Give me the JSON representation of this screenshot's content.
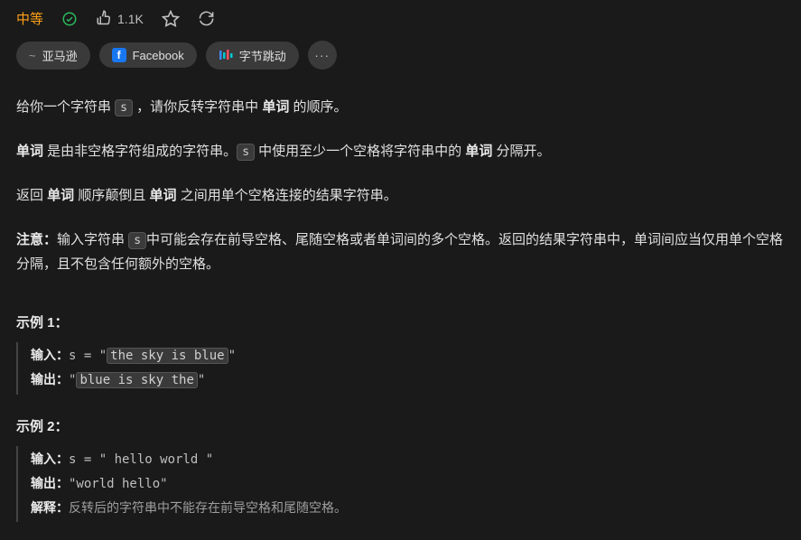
{
  "header": {
    "difficulty": "中等",
    "likes": "1.1K"
  },
  "tags": {
    "prefix": "~",
    "amazon": "亚马逊",
    "facebook": "Facebook",
    "bytedance": "字节跳动",
    "more": "···"
  },
  "problem": {
    "p1_a": "给你一个字符串 ",
    "p1_code": "s",
    "p1_b": " ，请你反转字符串中 ",
    "p1_bold": "单词",
    "p1_c": " 的顺序。",
    "p2_bold1": "单词",
    "p2_a": " 是由非空格字符组成的字符串。",
    "p2_code": "s",
    "p2_b": " 中使用至少一个空格将字符串中的 ",
    "p2_bold2": "单词",
    "p2_c": " 分隔开。",
    "p3_a": "返回 ",
    "p3_bold1": "单词",
    "p3_b": " 顺序颠倒且 ",
    "p3_bold2": "单词",
    "p3_c": " 之间用单个空格连接的结果字符串。",
    "p4_bold": "注意：",
    "p4_a": "输入字符串 ",
    "p4_code": "s",
    "p4_b": "中可能会存在前导空格、尾随空格或者单词间的多个空格。返回的结果字符串中，单词间应当仅用单个空格分隔，且不包含任何额外的空格。"
  },
  "examples": [
    {
      "title": "示例 1：",
      "input_label": "输入：",
      "input_value_a": "s = \"",
      "input_highlight": "the sky is blue",
      "input_value_b": "\"",
      "output_label": "输出：",
      "output_value_a": "\"",
      "output_highlight": "blue is sky the",
      "output_value_b": "\""
    },
    {
      "title": "示例 2：",
      "input_label": "输入：",
      "input_value": "s = \"  hello world  \"",
      "output_label": "输出：",
      "output_value": "\"world hello\"",
      "explain_label": "解释：",
      "explain_text": "反转后的字符串中不能存在前导空格和尾随空格。"
    }
  ]
}
